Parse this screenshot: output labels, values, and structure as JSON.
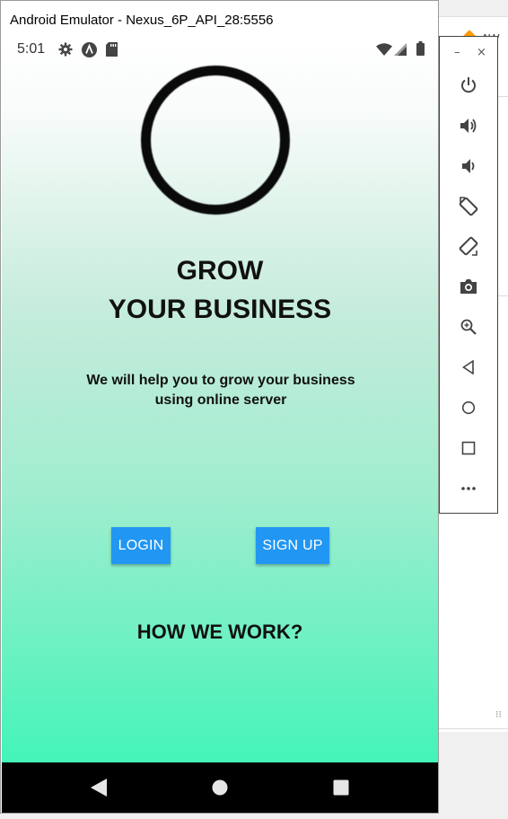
{
  "window": {
    "title": "Android Emulator - Nexus_6P_API_28:5556"
  },
  "status_bar": {
    "time": "5:01"
  },
  "hero": {
    "headline_line1": "GROW",
    "headline_line2": "YOUR BUSINESS",
    "subtitle": "We will help you to grow your business using online server"
  },
  "buttons": {
    "login": "LOGIN",
    "signup": "SIGN UP"
  },
  "section": {
    "how_we_work": "HOW WE WORK?"
  },
  "background_window": {
    "partial_text": "AW"
  },
  "colors": {
    "button": "#2196f3",
    "gradient_top": "#ffffff",
    "gradient_bottom": "#36f5b5",
    "navbar": "#000000"
  },
  "toolbar": {
    "window_controls": [
      "minimize-icon",
      "close-icon"
    ],
    "items": [
      "power-icon",
      "volume-up-icon",
      "volume-down-icon",
      "rotate-left-icon",
      "rotate-right-icon",
      "camera-icon",
      "zoom-icon",
      "back-icon",
      "home-icon",
      "overview-icon",
      "more-icon"
    ]
  }
}
